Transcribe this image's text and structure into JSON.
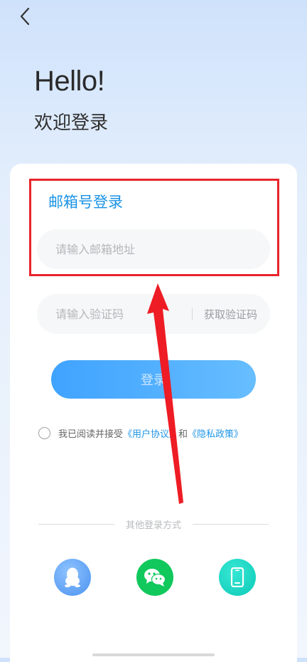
{
  "header": {
    "back_icon": "chevron-left-icon",
    "greeting": "Hello!",
    "subtitle": "欢迎登录"
  },
  "form": {
    "title": "邮箱号登录",
    "email_placeholder": "请输入邮箱地址",
    "code_placeholder": "请输入验证码",
    "get_code_label": "获取验证码",
    "login_button": "登录"
  },
  "agreement": {
    "prefix": "我已阅读并接受",
    "user_agreement": "《用户协议》",
    "and": "和",
    "privacy_policy": "《隐私政策》"
  },
  "other": {
    "label": "其他登录方式",
    "options": [
      {
        "name": "qq",
        "icon": "qq-penguin-icon",
        "color": "#4b92f0"
      },
      {
        "name": "wechat",
        "icon": "wechat-icon",
        "color": "#11c85c"
      },
      {
        "name": "phone",
        "icon": "phone-icon",
        "color": "#0ec9b7"
      }
    ]
  },
  "colors": {
    "accent": "#1a93e6",
    "highlight_border": "#e8242c",
    "annotation_arrow": "#ee1c24"
  }
}
